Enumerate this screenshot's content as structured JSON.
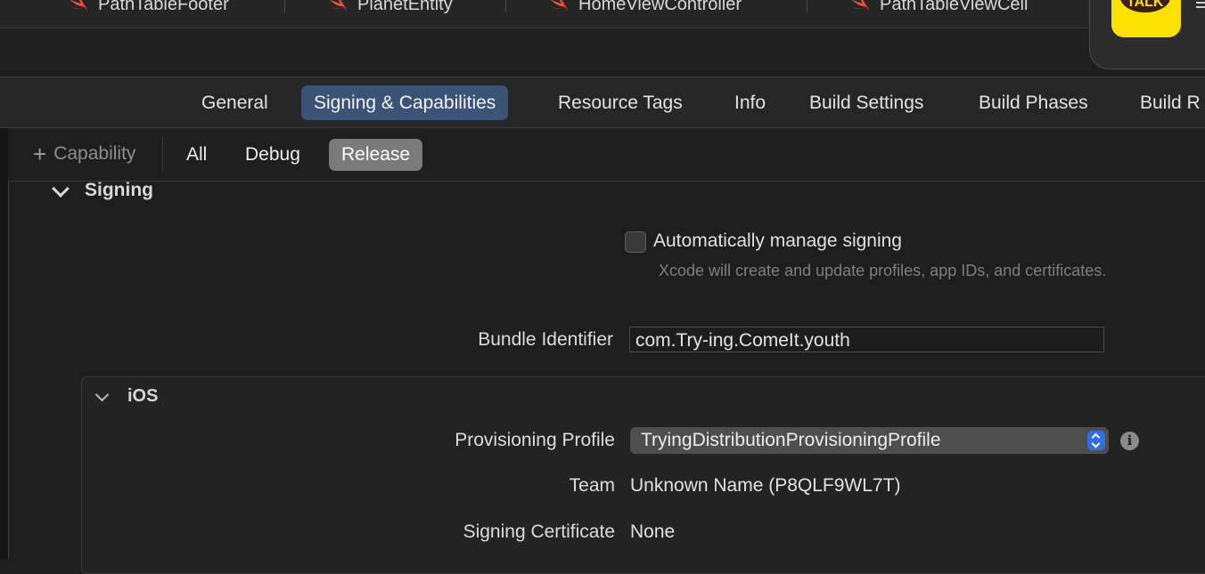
{
  "file_tabs": [
    {
      "label": "PathTableFooter",
      "icon": "swift-icon"
    },
    {
      "label": "PlanetEntity",
      "icon": "swift-icon"
    },
    {
      "label": "HomeViewController",
      "icon": "swift-icon"
    },
    {
      "label": "PathTableViewCell",
      "icon": "swift-icon"
    }
  ],
  "app_icon": {
    "label": "TALK",
    "color": "#fae100"
  },
  "editor_tabs": [
    "General",
    "Signing & Capabilities",
    "Resource Tags",
    "Info",
    "Build Settings",
    "Build Phases",
    "Build R"
  ],
  "selected_editor_tab": "Signing & Capabilities",
  "subbar": {
    "add_capability": "Capability",
    "configs": [
      "All",
      "Debug",
      "Release"
    ],
    "selected_config": "Release"
  },
  "signing": {
    "title": "Signing",
    "auto_manage_label": "Automatically manage signing",
    "auto_manage_checked": false,
    "auto_manage_hint": "Xcode will create and update profiles, app IDs, and certificates.",
    "bundle_label": "Bundle Identifier",
    "bundle_value": "com.Try-ing.ComeIt.youth"
  },
  "ios": {
    "title": "iOS",
    "profile_label": "Provisioning Profile",
    "profile_value": "TryingDistributionProvisioningProfile",
    "team_label": "Team",
    "team_value": "Unknown Name (P8QLF9WL7T)",
    "cert_label": "Signing Certificate",
    "cert_value": "None"
  },
  "colors": {
    "accent": "#3a5376",
    "swift": "#f05138",
    "popup_stepper": "#2f6de1"
  }
}
